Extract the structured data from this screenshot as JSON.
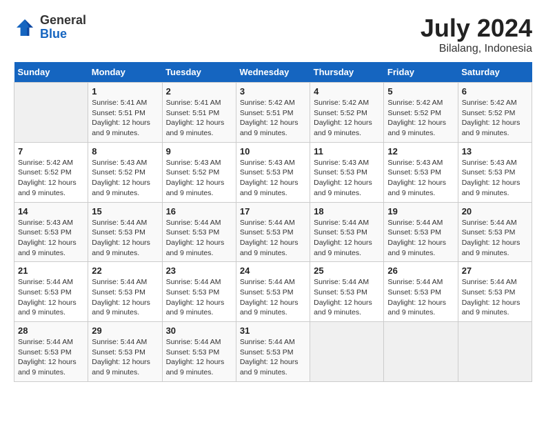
{
  "header": {
    "logo": {
      "general": "General",
      "blue": "Blue"
    },
    "title": "July 2024",
    "location": "Bilalang, Indonesia"
  },
  "weekdays": [
    "Sunday",
    "Monday",
    "Tuesday",
    "Wednesday",
    "Thursday",
    "Friday",
    "Saturday"
  ],
  "weeks": [
    [
      {
        "day": "",
        "info": ""
      },
      {
        "day": "1",
        "info": "Sunrise: 5:41 AM\nSunset: 5:51 PM\nDaylight: 12 hours\nand 9 minutes."
      },
      {
        "day": "2",
        "info": "Sunrise: 5:41 AM\nSunset: 5:51 PM\nDaylight: 12 hours\nand 9 minutes."
      },
      {
        "day": "3",
        "info": "Sunrise: 5:42 AM\nSunset: 5:51 PM\nDaylight: 12 hours\nand 9 minutes."
      },
      {
        "day": "4",
        "info": "Sunrise: 5:42 AM\nSunset: 5:52 PM\nDaylight: 12 hours\nand 9 minutes."
      },
      {
        "day": "5",
        "info": "Sunrise: 5:42 AM\nSunset: 5:52 PM\nDaylight: 12 hours\nand 9 minutes."
      },
      {
        "day": "6",
        "info": "Sunrise: 5:42 AM\nSunset: 5:52 PM\nDaylight: 12 hours\nand 9 minutes."
      }
    ],
    [
      {
        "day": "7",
        "info": "Sunrise: 5:42 AM\nSunset: 5:52 PM\nDaylight: 12 hours\nand 9 minutes."
      },
      {
        "day": "8",
        "info": "Sunrise: 5:43 AM\nSunset: 5:52 PM\nDaylight: 12 hours\nand 9 minutes."
      },
      {
        "day": "9",
        "info": "Sunrise: 5:43 AM\nSunset: 5:52 PM\nDaylight: 12 hours\nand 9 minutes."
      },
      {
        "day": "10",
        "info": "Sunrise: 5:43 AM\nSunset: 5:53 PM\nDaylight: 12 hours\nand 9 minutes."
      },
      {
        "day": "11",
        "info": "Sunrise: 5:43 AM\nSunset: 5:53 PM\nDaylight: 12 hours\nand 9 minutes."
      },
      {
        "day": "12",
        "info": "Sunrise: 5:43 AM\nSunset: 5:53 PM\nDaylight: 12 hours\nand 9 minutes."
      },
      {
        "day": "13",
        "info": "Sunrise: 5:43 AM\nSunset: 5:53 PM\nDaylight: 12 hours\nand 9 minutes."
      }
    ],
    [
      {
        "day": "14",
        "info": "Sunrise: 5:43 AM\nSunset: 5:53 PM\nDaylight: 12 hours\nand 9 minutes."
      },
      {
        "day": "15",
        "info": "Sunrise: 5:44 AM\nSunset: 5:53 PM\nDaylight: 12 hours\nand 9 minutes."
      },
      {
        "day": "16",
        "info": "Sunrise: 5:44 AM\nSunset: 5:53 PM\nDaylight: 12 hours\nand 9 minutes."
      },
      {
        "day": "17",
        "info": "Sunrise: 5:44 AM\nSunset: 5:53 PM\nDaylight: 12 hours\nand 9 minutes."
      },
      {
        "day": "18",
        "info": "Sunrise: 5:44 AM\nSunset: 5:53 PM\nDaylight: 12 hours\nand 9 minutes."
      },
      {
        "day": "19",
        "info": "Sunrise: 5:44 AM\nSunset: 5:53 PM\nDaylight: 12 hours\nand 9 minutes."
      },
      {
        "day": "20",
        "info": "Sunrise: 5:44 AM\nSunset: 5:53 PM\nDaylight: 12 hours\nand 9 minutes."
      }
    ],
    [
      {
        "day": "21",
        "info": "Sunrise: 5:44 AM\nSunset: 5:53 PM\nDaylight: 12 hours\nand 9 minutes."
      },
      {
        "day": "22",
        "info": "Sunrise: 5:44 AM\nSunset: 5:53 PM\nDaylight: 12 hours\nand 9 minutes."
      },
      {
        "day": "23",
        "info": "Sunrise: 5:44 AM\nSunset: 5:53 PM\nDaylight: 12 hours\nand 9 minutes."
      },
      {
        "day": "24",
        "info": "Sunrise: 5:44 AM\nSunset: 5:53 PM\nDaylight: 12 hours\nand 9 minutes."
      },
      {
        "day": "25",
        "info": "Sunrise: 5:44 AM\nSunset: 5:53 PM\nDaylight: 12 hours\nand 9 minutes."
      },
      {
        "day": "26",
        "info": "Sunrise: 5:44 AM\nSunset: 5:53 PM\nDaylight: 12 hours\nand 9 minutes."
      },
      {
        "day": "27",
        "info": "Sunrise: 5:44 AM\nSunset: 5:53 PM\nDaylight: 12 hours\nand 9 minutes."
      }
    ],
    [
      {
        "day": "28",
        "info": "Sunrise: 5:44 AM\nSunset: 5:53 PM\nDaylight: 12 hours\nand 9 minutes."
      },
      {
        "day": "29",
        "info": "Sunrise: 5:44 AM\nSunset: 5:53 PM\nDaylight: 12 hours\nand 9 minutes."
      },
      {
        "day": "30",
        "info": "Sunrise: 5:44 AM\nSunset: 5:53 PM\nDaylight: 12 hours\nand 9 minutes."
      },
      {
        "day": "31",
        "info": "Sunrise: 5:44 AM\nSunset: 5:53 PM\nDaylight: 12 hours\nand 9 minutes."
      },
      {
        "day": "",
        "info": ""
      },
      {
        "day": "",
        "info": ""
      },
      {
        "day": "",
        "info": ""
      }
    ]
  ]
}
